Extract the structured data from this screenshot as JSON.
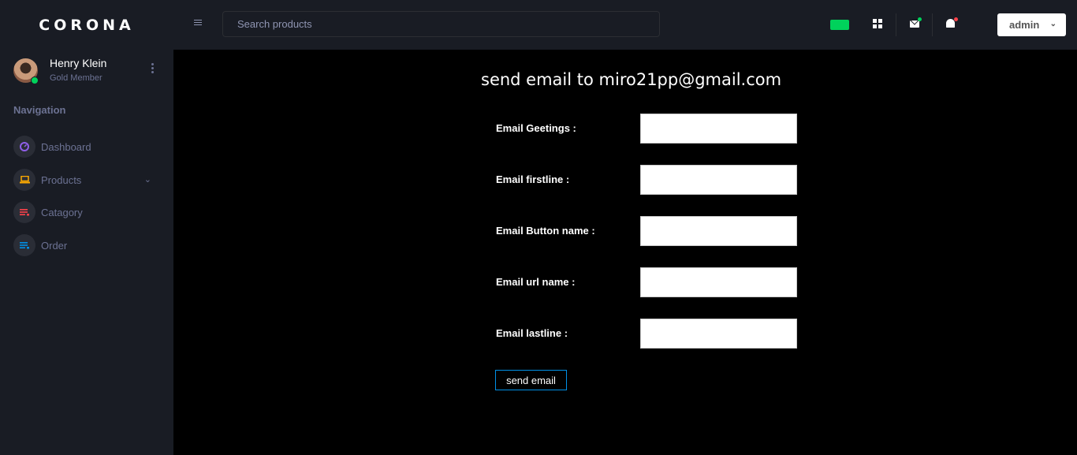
{
  "brand": "CORONA",
  "profile": {
    "name": "Henry Klein",
    "role": "Gold Member"
  },
  "nav": {
    "title": "Navigation",
    "items": [
      {
        "label": "Dashboard",
        "icon": "speedometer-icon",
        "color": "#8f5fe8"
      },
      {
        "label": "Products",
        "icon": "laptop-icon",
        "color": "#ffab00"
      },
      {
        "label": "Catagory",
        "icon": "list-icon",
        "color": "#fc424a"
      },
      {
        "label": "Order",
        "icon": "list-icon",
        "color": "#0090e7"
      }
    ]
  },
  "topbar": {
    "search_placeholder": "Search products",
    "user_menu_label": "admin"
  },
  "form": {
    "title": "send email to miro21pp@gmail.com",
    "fields": [
      {
        "label": "Email Geetings :",
        "value": ""
      },
      {
        "label": "Email firstline :",
        "value": ""
      },
      {
        "label": "Email Button name :",
        "value": ""
      },
      {
        "label": "Email url name :",
        "value": ""
      },
      {
        "label": "Email lastline :",
        "value": ""
      }
    ],
    "submit_label": "send email"
  },
  "colors": {
    "sidebar_bg": "#191c24",
    "main_bg": "#000000",
    "accent_green": "#00d25b",
    "accent_blue": "#0090e7",
    "accent_red": "#fc424a"
  }
}
